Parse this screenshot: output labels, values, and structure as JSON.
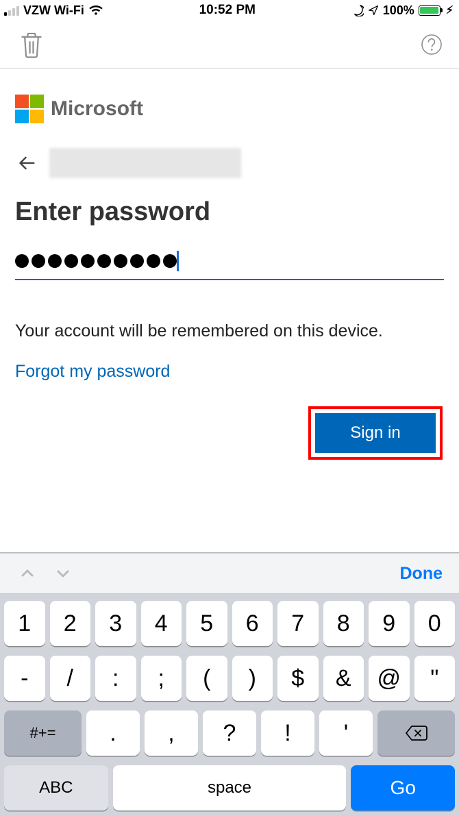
{
  "status": {
    "carrier": "VZW Wi-Fi",
    "time": "10:52 PM",
    "battery_pct": "100%"
  },
  "brand": {
    "name": "Microsoft"
  },
  "page": {
    "heading": "Enter password",
    "password_dots_count": 10,
    "remember_text": "Your account will be remembered on this device.",
    "forgot_link": "Forgot my password",
    "signin_label": "Sign in"
  },
  "keyboard": {
    "done": "Done",
    "row1": [
      "1",
      "2",
      "3",
      "4",
      "5",
      "6",
      "7",
      "8",
      "9",
      "0"
    ],
    "row2": [
      "-",
      "/",
      ":",
      ";",
      "(",
      ")",
      "$",
      "&",
      "@",
      "\""
    ],
    "row3": {
      "shift": "#+=",
      "keys": [
        ".",
        ",",
        "?",
        "!",
        "'"
      ],
      "delete": "delete"
    },
    "row4": {
      "abc": "ABC",
      "space": "space",
      "go": "Go"
    }
  },
  "icons": {
    "trash": "trash-icon",
    "help": "help-icon",
    "back": "back-arrow-icon",
    "wifi": "wifi-icon",
    "moon": "dnd-moon-icon",
    "location": "location-icon",
    "lightning": "charging-icon"
  }
}
